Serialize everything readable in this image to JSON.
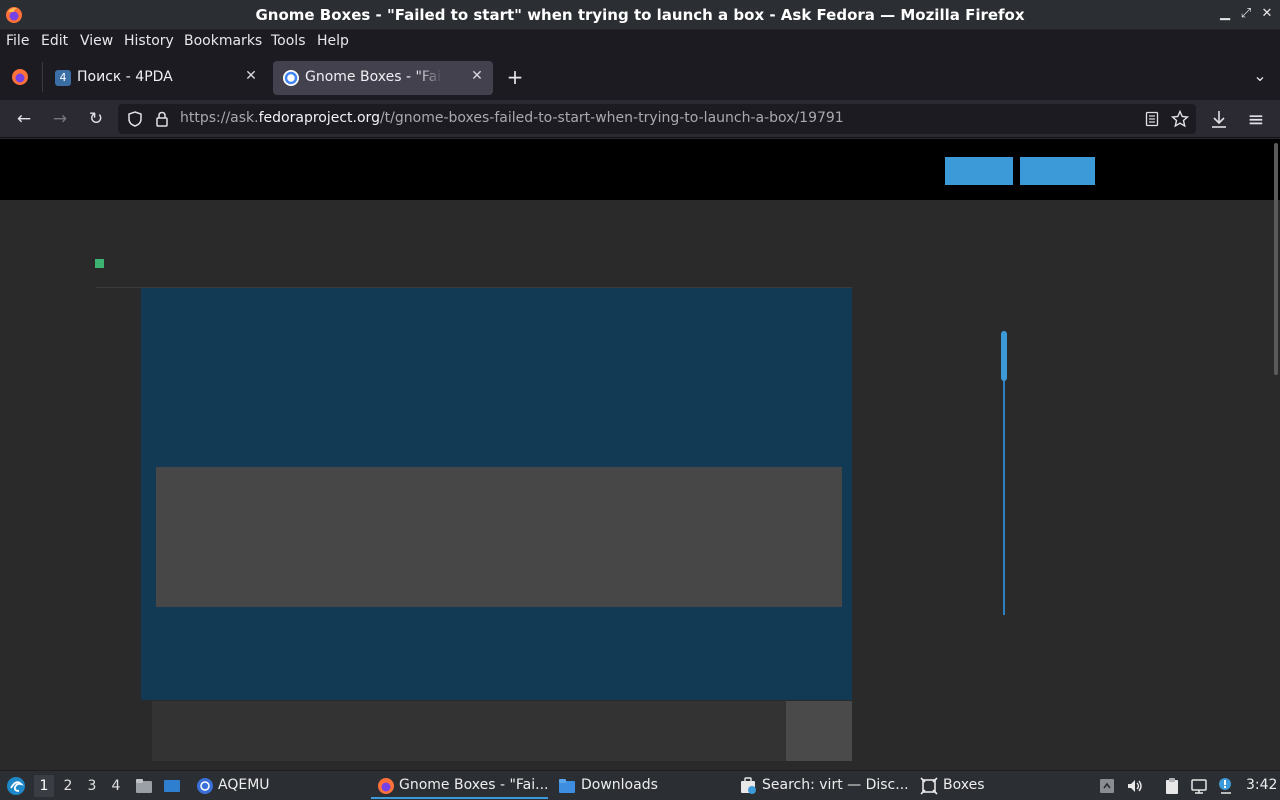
{
  "window": {
    "title": "Gnome Boxes - \"Failed to start\" when trying to launch a box - Ask Fedora — Mozilla Firefox",
    "minimize_glyph": "▁",
    "maximize_glyph": "⤢",
    "close_glyph": "✕"
  },
  "menubar": {
    "items": [
      "File",
      "Edit",
      "View",
      "History",
      "Bookmarks",
      "Tools",
      "Help"
    ]
  },
  "tabs": [
    {
      "label": "Поиск - 4PDA",
      "active": false,
      "icon": "4pda-favicon-icon"
    },
    {
      "label": "Gnome Boxes - \"Failed to start\"",
      "active": true,
      "icon": "google-favicon-icon"
    }
  ],
  "tab_close_glyph": "✕",
  "new_tab_glyph": "+",
  "tab_list_glyph": "⌄",
  "navbar": {
    "url_prefix": "https://ask.",
    "url_domain": "fedoraproject.org",
    "url_path": "/t/gnome-boxes-failed-to-start-when-trying-to-launch-a-box/19791",
    "back_glyph": "←",
    "forward_glyph": "→",
    "reload_glyph": "↻",
    "menu_glyph": "≡"
  },
  "page": {
    "header_color": "#000000",
    "accent_color": "#3d9ad8",
    "panel_color": "#133a55"
  },
  "taskbar": {
    "workspaces": [
      "1",
      "2",
      "3",
      "4"
    ],
    "active_workspace": "1",
    "apps": [
      {
        "label": "AQEMU",
        "icon": "aqemu-icon"
      },
      {
        "label": "Gnome Boxes - \"Fai...",
        "icon": "firefox-icon",
        "active": true
      },
      {
        "label": "Downloads",
        "icon": "folder-icon"
      },
      {
        "label": "Search: virt — Disc...",
        "icon": "discover-icon"
      },
      {
        "label": "Boxes",
        "icon": "boxes-icon"
      }
    ],
    "clock": "3:42"
  }
}
